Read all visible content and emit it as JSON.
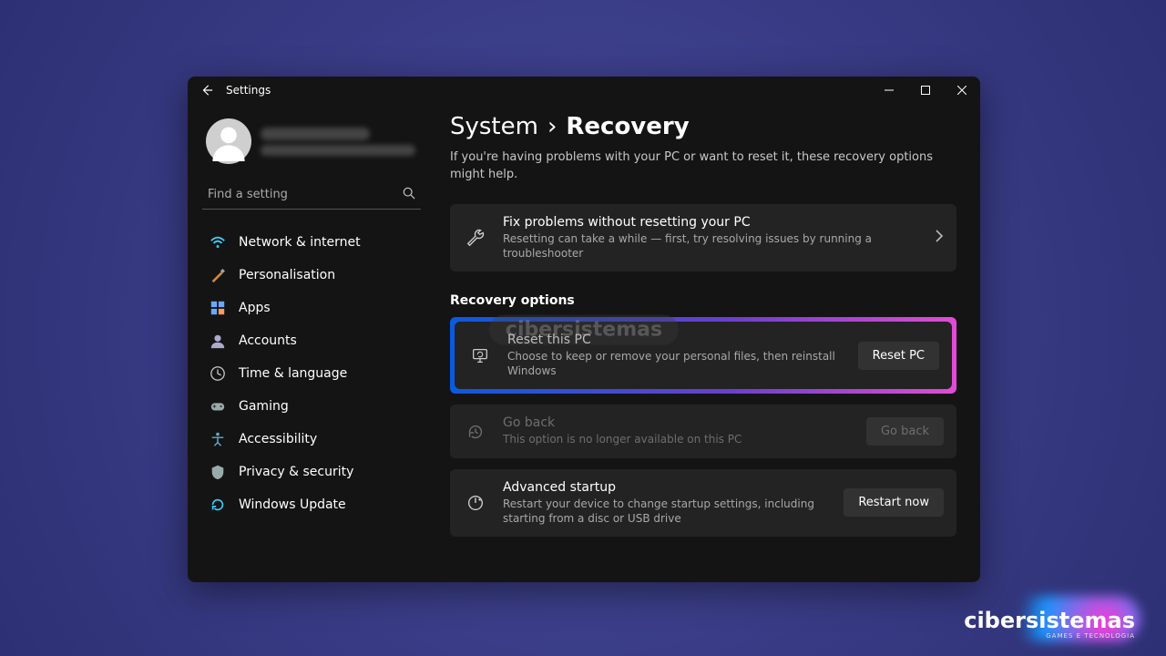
{
  "titlebar": {
    "title": "Settings"
  },
  "sidebar": {
    "search_placeholder": "Find a setting",
    "items": [
      {
        "label": "Network & internet"
      },
      {
        "label": "Personalisation"
      },
      {
        "label": "Apps"
      },
      {
        "label": "Accounts"
      },
      {
        "label": "Time & language"
      },
      {
        "label": "Gaming"
      },
      {
        "label": "Accessibility"
      },
      {
        "label": "Privacy & security"
      },
      {
        "label": "Windows Update"
      }
    ]
  },
  "breadcrumb": {
    "parent": "System",
    "sep": "›",
    "current": "Recovery"
  },
  "intro": "If you're having problems with your PC or want to reset it, these recovery options might help.",
  "cards": {
    "fix": {
      "title": "Fix problems without resetting your PC",
      "desc": "Resetting can take a while — first, try resolving issues by running a troubleshooter"
    },
    "section": "Recovery options",
    "reset": {
      "title": "Reset this PC",
      "desc": "Choose to keep or remove your personal files, then reinstall Windows",
      "button": "Reset PC"
    },
    "goback": {
      "title": "Go back",
      "desc": "This option is no longer available on this PC",
      "button": "Go back"
    },
    "advanced": {
      "title": "Advanced startup",
      "desc": "Restart your device to change startup settings, including starting from a disc or USB drive",
      "button": "Restart now"
    }
  },
  "watermark": "cibersistemas",
  "logo": {
    "name": "cibersistemas",
    "tag": "GAMES E TECNOLOGIA"
  }
}
